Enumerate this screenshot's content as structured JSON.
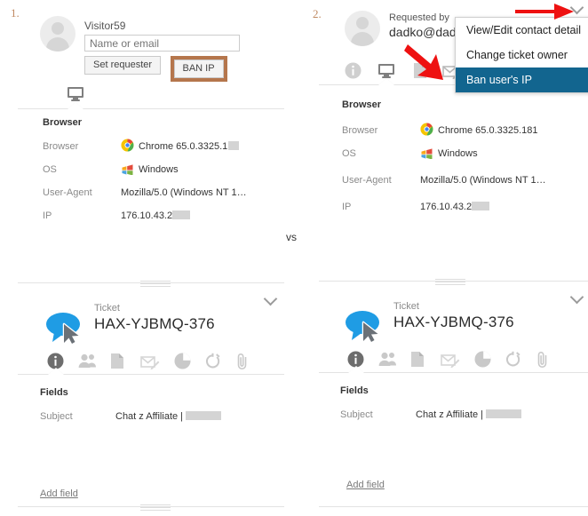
{
  "annotations": {
    "step_one": "1.",
    "step_two": "2.",
    "vs": "vs",
    "accent_color": "#c08a62",
    "arrow_color": "#ee1111",
    "highlight_border": "#b5764c",
    "menu_selected_bg": "#12658f"
  },
  "left_panel": {
    "requester": {
      "name": "Visitor59",
      "input_placeholder": "Name or email",
      "input_value": "",
      "set_requester_label": "Set requester",
      "ban_ip_label": "BAN IP"
    },
    "tabs": [
      {
        "name": "monitor-icon",
        "active": true
      }
    ],
    "browser_section": {
      "title": "Browser",
      "rows": [
        {
          "label": "Browser",
          "value": "Chrome 65.0.3325.1",
          "icon": "chrome-icon",
          "redacted": true
        },
        {
          "label": "OS",
          "value": "Windows",
          "icon": "windows-icon",
          "redacted": false
        },
        {
          "label": "User-Agent",
          "value": "Mozilla/5.0 (Windows NT 1…",
          "icon": "",
          "redacted": false
        },
        {
          "label": "IP",
          "value": "176.10.43.2",
          "icon": "",
          "redacted": true
        }
      ]
    },
    "ticket": {
      "label": "Ticket",
      "id": "HAX-YJBMQ-376",
      "icons": [
        "info-icon",
        "people-icon",
        "document-icon",
        "envelope-edit-icon",
        "pie-chart-icon",
        "timer-icon",
        "paperclip-icon"
      ],
      "fields_title": "Fields",
      "fields": [
        {
          "label": "Subject",
          "value": "Chat z Affiliate |",
          "redacted": true
        }
      ],
      "add_field_label": "Add field"
    }
  },
  "right_panel": {
    "requester": {
      "label": "Requested by",
      "email": "dadko@dadi",
      "chevron": "chevron-down-icon"
    },
    "menu": {
      "items": [
        {
          "label": "View/Edit contact detail",
          "selected": false
        },
        {
          "label": "Change ticket owner",
          "selected": false
        },
        {
          "label": "Ban user's IP",
          "selected": true
        }
      ]
    },
    "tabs": [
      {
        "name": "info-icon",
        "active": false
      },
      {
        "name": "monitor-icon",
        "active": true
      },
      {
        "name": "document-icon",
        "active": false
      },
      {
        "name": "envelope-edit-icon",
        "active": false
      }
    ],
    "browser_section": {
      "title": "Browser",
      "rows": [
        {
          "label": "Browser",
          "value": "Chrome 65.0.3325.181",
          "icon": "chrome-icon",
          "redacted": false
        },
        {
          "label": "OS",
          "value": "Windows",
          "icon": "windows-icon",
          "redacted": false
        },
        {
          "label": "User-Agent",
          "value": "Mozilla/5.0 (Windows NT 1…",
          "icon": "",
          "redacted": false
        },
        {
          "label": "IP",
          "value": "176.10.43.2",
          "icon": "",
          "redacted": true
        }
      ]
    },
    "ticket": {
      "label": "Ticket",
      "id": "HAX-YJBMQ-376",
      "icons": [
        "info-icon",
        "people-icon",
        "document-icon",
        "envelope-edit-icon",
        "pie-chart-icon",
        "timer-icon",
        "paperclip-icon"
      ],
      "fields_title": "Fields",
      "fields": [
        {
          "label": "Subject",
          "value": "Chat z Affiliate |",
          "redacted": true
        }
      ],
      "add_field_label": "Add field"
    }
  }
}
